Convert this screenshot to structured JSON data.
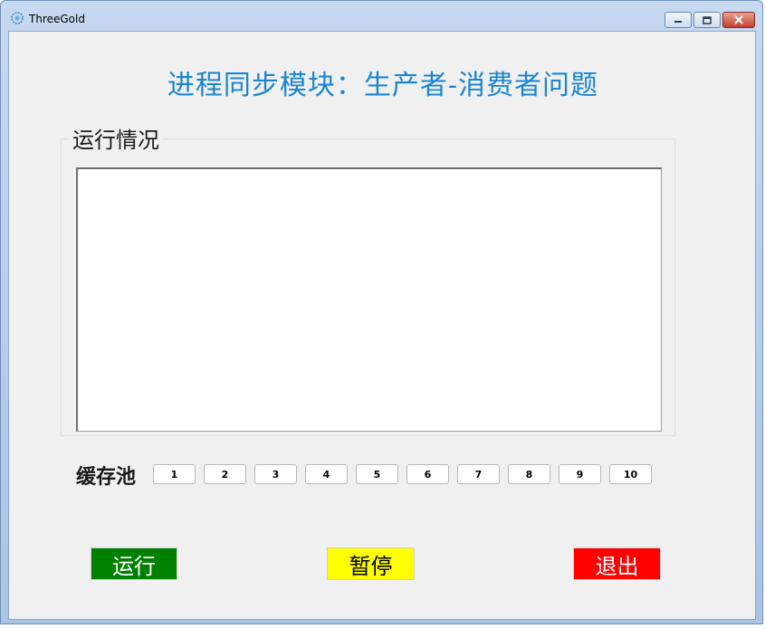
{
  "window": {
    "title": "ThreeGold"
  },
  "main": {
    "heading": "进程同步模块：生产者-消费者问题",
    "heading_color": "#1a86d0",
    "log_group_label": "运行情况",
    "log_text": "",
    "buffer_label": "缓存池",
    "buffer_slots": [
      "1",
      "2",
      "3",
      "4",
      "5",
      "6",
      "7",
      "8",
      "9",
      "10"
    ]
  },
  "buttons": {
    "run": {
      "label": "运行",
      "bg": "#008000",
      "fg": "#ffffff"
    },
    "pause": {
      "label": "暂停",
      "bg": "#ffff00",
      "fg": "#000000"
    },
    "exit": {
      "label": "退出",
      "bg": "#ff0000",
      "fg": "#ffffff"
    }
  },
  "icons": {
    "app": "gear-icon",
    "minimize": "minimize-icon",
    "maximize": "maximize-icon",
    "close": "close-icon"
  }
}
